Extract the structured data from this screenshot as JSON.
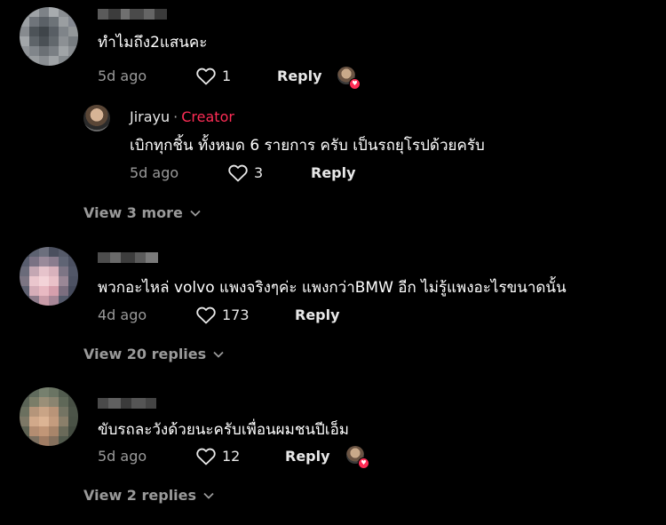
{
  "comments": [
    {
      "text": "ทำไมถึง2แสนคะ",
      "age": "5d ago",
      "likes": "1",
      "reply_label": "Reply",
      "icons": {
        "like": "heart-outline-icon",
        "liked_by": "creator-liked-heart-icon"
      },
      "replies": [
        {
          "username": "Jirayu",
          "separator": "·",
          "badge": "Creator",
          "text": "เบิกทุกชิ้น ทั้งหมด 6 รายการ ครับ เป็นรถยุโรปด้วยครับ",
          "age": "5d ago",
          "likes": "3",
          "reply_label": "Reply"
        }
      ],
      "view_more": "View 3 more"
    },
    {
      "text": "พวกอะไหล่ volvo แพงจริงๆค่ะ แพงกว่าBMW อีก ไม่รู้แพงอะไรขนาดนั้น",
      "age": "4d ago",
      "likes": "173",
      "reply_label": "Reply",
      "view_more": "View 20 replies"
    },
    {
      "text": "ขับรถละวังด้วยนะครับเพื่อนผมชนปีเอ็ม",
      "age": "5d ago",
      "likes": "12",
      "reply_label": "Reply",
      "icons": {
        "like": "heart-outline-icon",
        "liked_by": "creator-liked-heart-icon"
      },
      "view_more": "View 2 replies"
    }
  ],
  "colors": {
    "background": "#000000",
    "creator_badge": "#fe2c55",
    "muted": "#9a9a9a"
  }
}
